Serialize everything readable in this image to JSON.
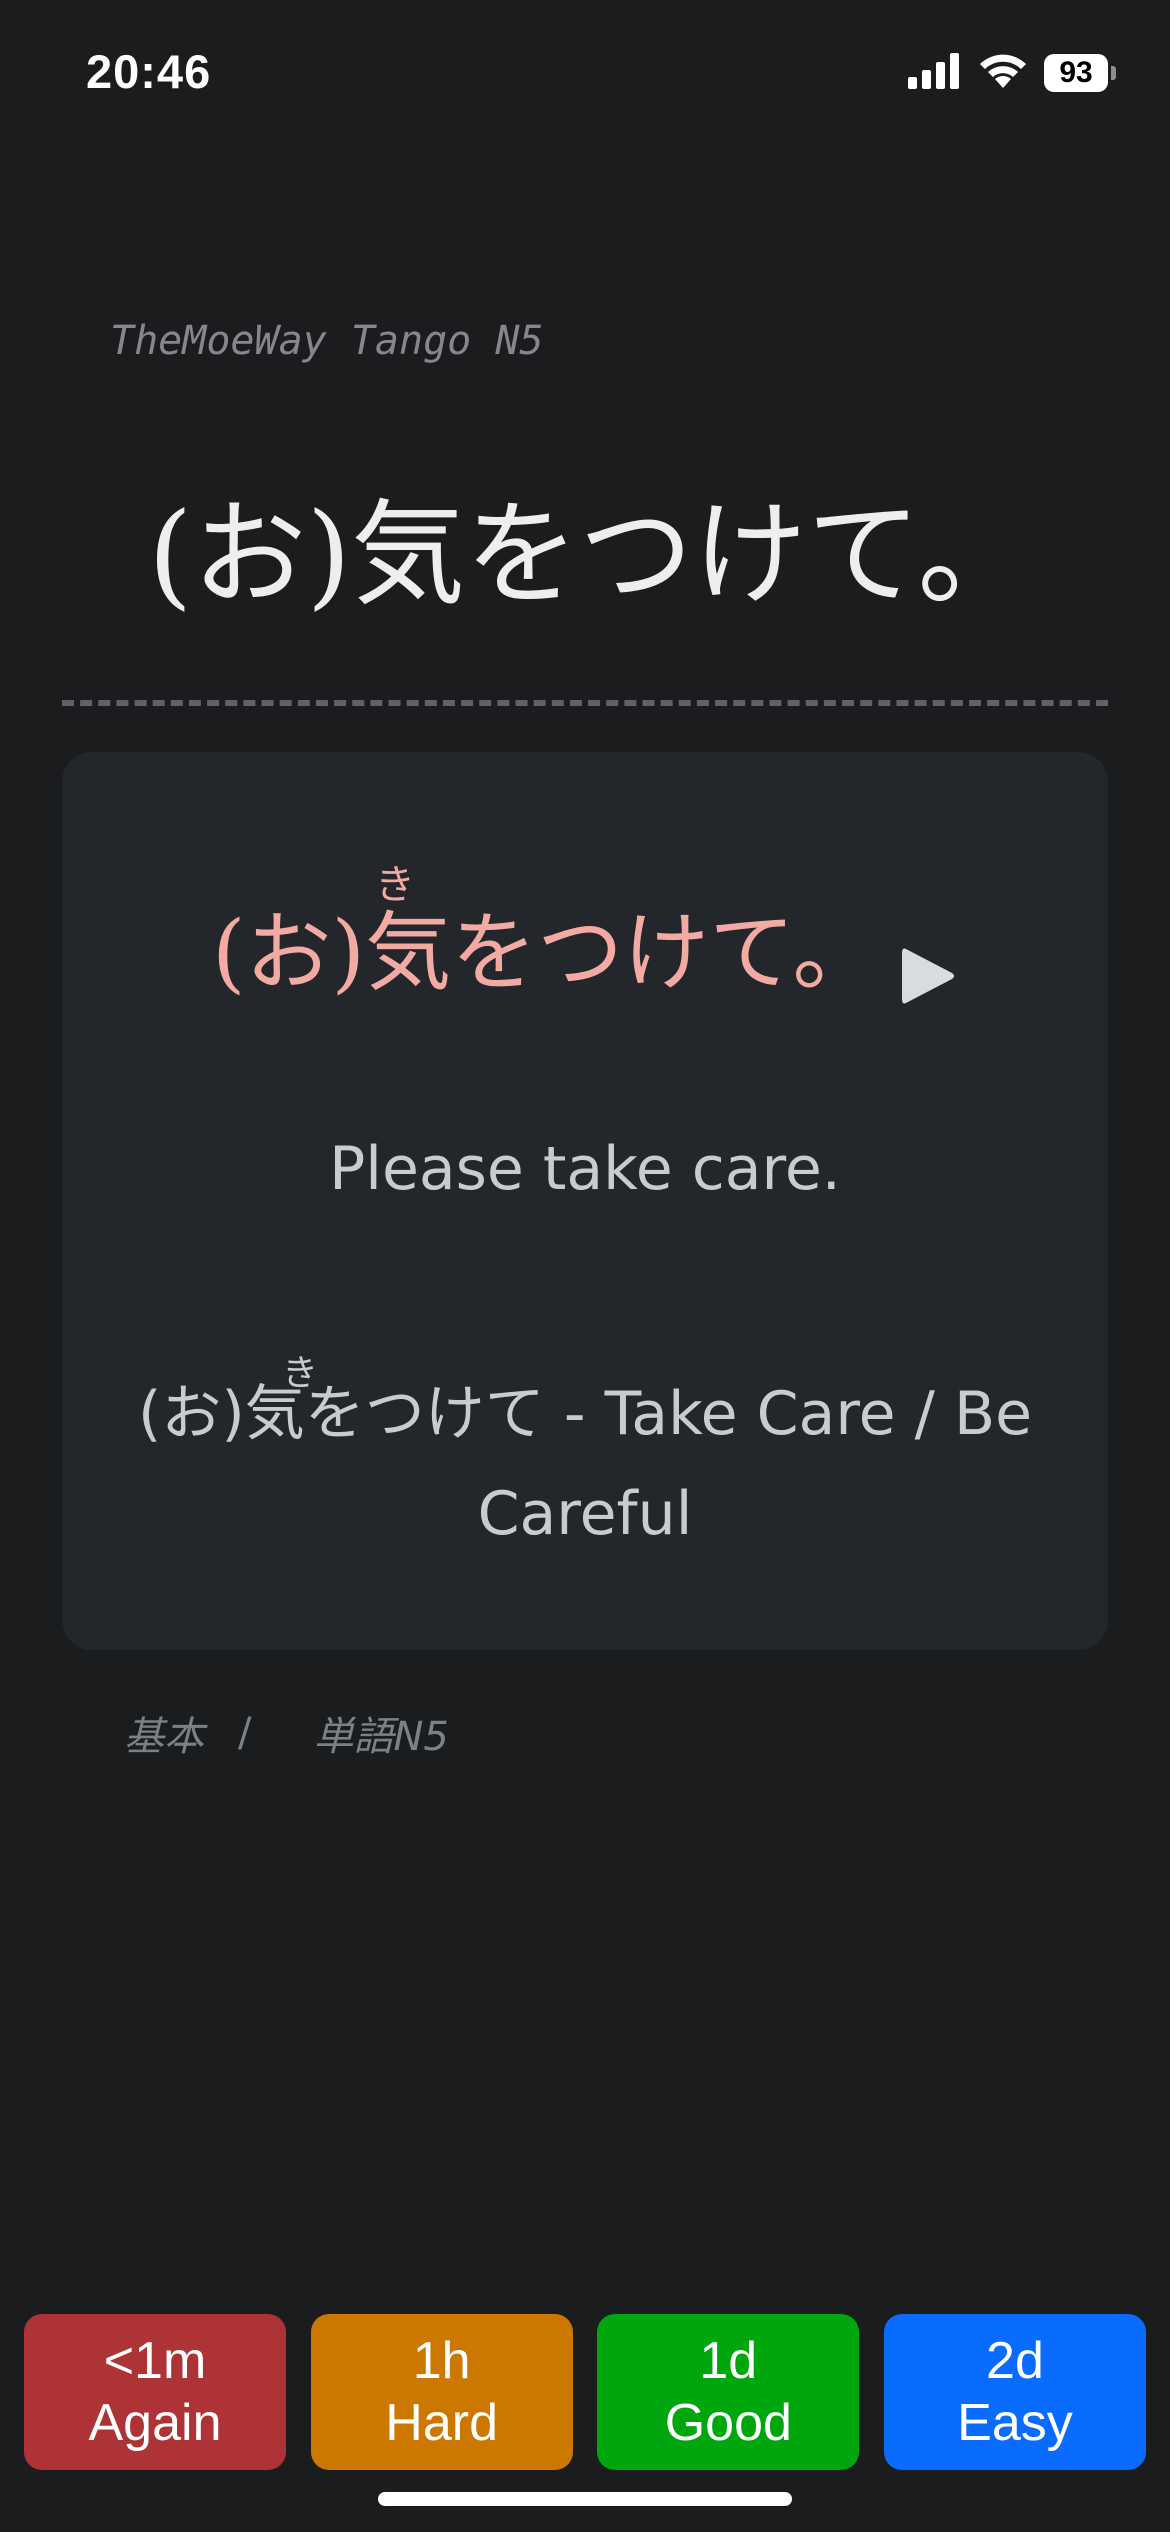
{
  "status_bar": {
    "time": "20:46",
    "battery": "93",
    "icons": [
      "signal-icon",
      "wifi-icon",
      "battery-icon"
    ]
  },
  "front": {
    "deck_name": "TheMoeWay Tango N5",
    "expression": "(お)気をつけて。"
  },
  "back": {
    "expression_reading": "(お)気をつけて。",
    "furigana": "き",
    "meaning": "Please take care.",
    "sentence": "(お)気をつけて - Take Care / Be Careful",
    "sentence_furigana": "き"
  },
  "tags": {
    "items": [
      "基本",
      "単語N5"
    ],
    "separator": "/"
  },
  "answer_buttons": [
    {
      "interval": "<1m",
      "label": "Again",
      "color": "#ad3337"
    },
    {
      "interval": "1h",
      "label": "Hard",
      "color": "#cc7800"
    },
    {
      "interval": "1d",
      "label": "Good",
      "color": "#00a60d"
    },
    {
      "interval": "2d",
      "label": "Easy",
      "color": "#0a6cff"
    }
  ],
  "colors": {
    "background": "#1b1c1e",
    "card": "#23272b",
    "accent_reading": "#f2aaa2"
  }
}
